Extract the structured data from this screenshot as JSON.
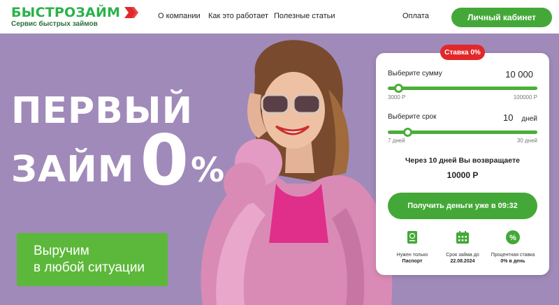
{
  "header": {
    "logo_title": "БЫСТРОЗАЙМ",
    "logo_subtitle": "Сервис быстрых займов",
    "nav": [
      "О компании",
      "Как это работает",
      "Полезные статьи",
      "Оплата"
    ],
    "cabinet_label": "Личный кабинет"
  },
  "hero": {
    "headline_line1": "ПЕРВЫЙ",
    "headline_line2": "ЗАЙМ",
    "headline_zero": "0",
    "headline_pct": "%",
    "promo_line1": "Выручим",
    "promo_line2": "в любой ситуации"
  },
  "calculator": {
    "rate_badge": "Ставка 0%",
    "amount": {
      "label": "Выберите сумму",
      "value": "10 000",
      "min_label": "3000 Р",
      "max_label": "100000 Р",
      "min": 3000,
      "max": 100000,
      "current": 10000
    },
    "term": {
      "label": "Выберите срок",
      "value": "10",
      "unit": "дней",
      "min_label": "7 дней",
      "max_label": "30 дней",
      "min": 7,
      "max": 30,
      "current": 10
    },
    "return_text": "Через 10 дней Вы возвращаете",
    "return_value": "10000 Р",
    "cta_label": "Получить деньги уже в 09:32",
    "features": [
      {
        "title": "Нужен только",
        "value": "Паспорт",
        "icon": "passport-icon"
      },
      {
        "title": "Срок займа до",
        "value": "22.08.2024",
        "icon": "calendar-icon"
      },
      {
        "title": "Процентная ставка",
        "value": "0% в день",
        "icon": "percent-icon"
      }
    ]
  },
  "colors": {
    "brand_green": "#43a837",
    "hero_bg": "#a08ab9",
    "badge_red": "#e2282a"
  }
}
